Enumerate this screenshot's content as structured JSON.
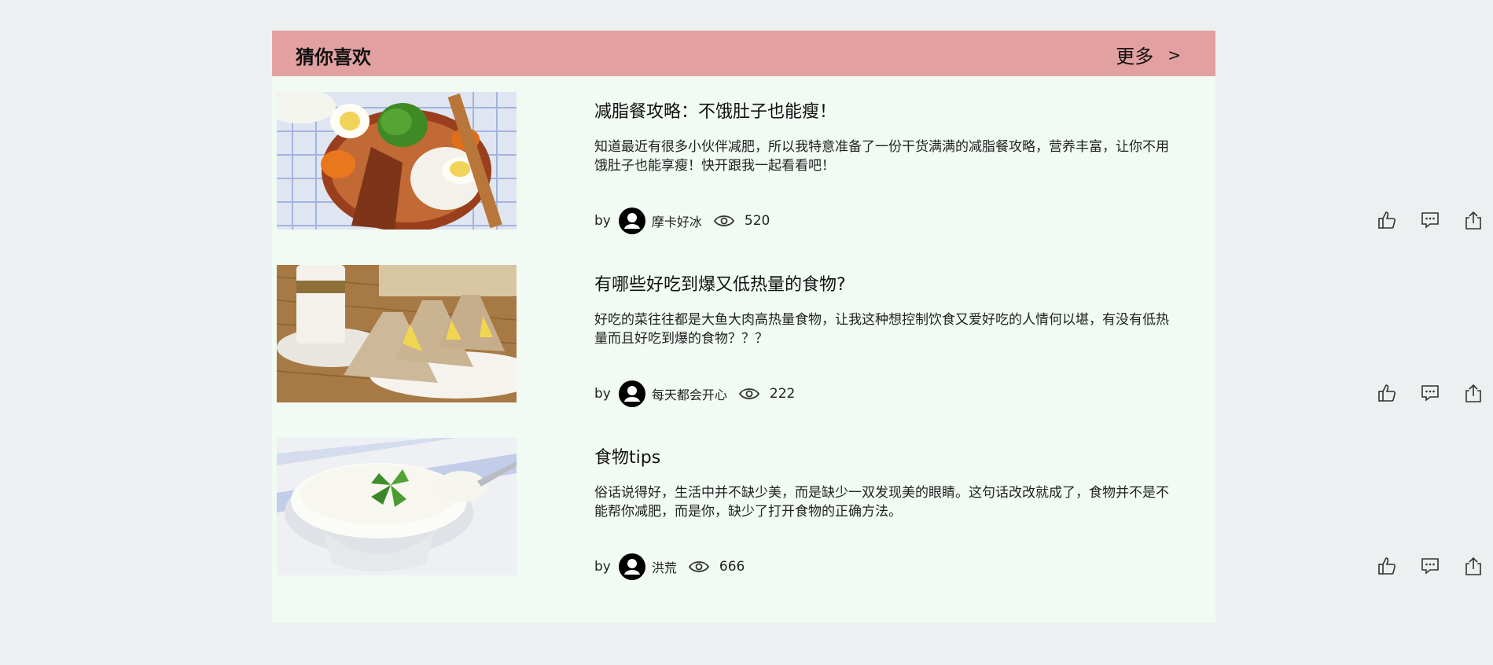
{
  "section": {
    "title": "猜你喜欢",
    "more_label": "更多",
    "more_arrow": ">"
  },
  "colors": {
    "header_bg": "#e2a0a0",
    "panel_bg": "#f1faf3",
    "page_bg": "#edf0f0"
  },
  "icons": {
    "avatar": "user-avatar-icon",
    "views": "eye-icon",
    "like": "thumbs-up-icon",
    "comment": "comment-icon",
    "share": "share-icon"
  },
  "articles": [
    {
      "title": "减脂餐攻略：不饿肚子也能瘦！",
      "desc": "知道最近有很多小伙伴减肥，所以我特意准备了一份干货满满的减脂餐攻略，营养丰富，让你不用饿肚子也能享瘦！快开跟我一起看看吧！",
      "by": "by",
      "author": "摩卡好冰",
      "views": "520",
      "image": "bento-lunch-image"
    },
    {
      "title": "有哪些好吃到爆又低热量的食物?",
      "desc": "好吃的菜往往都是大鱼大肉高热量食物，让我这种想控制饮食又爱好吃的人情何以堪，有没有低热量而且好吃到爆的食物？？？",
      "by": "by",
      "author": "每天都会开心",
      "views": "222",
      "image": "sandwich-image"
    },
    {
      "title": "食物tips",
      "desc": "俗话说得好，生活中并不缺少美，而是缺少一双发现美的眼睛。这句话改改就成了，食物并不是不能帮你减肥，而是你，缺少了打开食物的正确方法。",
      "by": "by",
      "author": "洪荒",
      "views": "666",
      "image": "yogurt-image"
    }
  ]
}
